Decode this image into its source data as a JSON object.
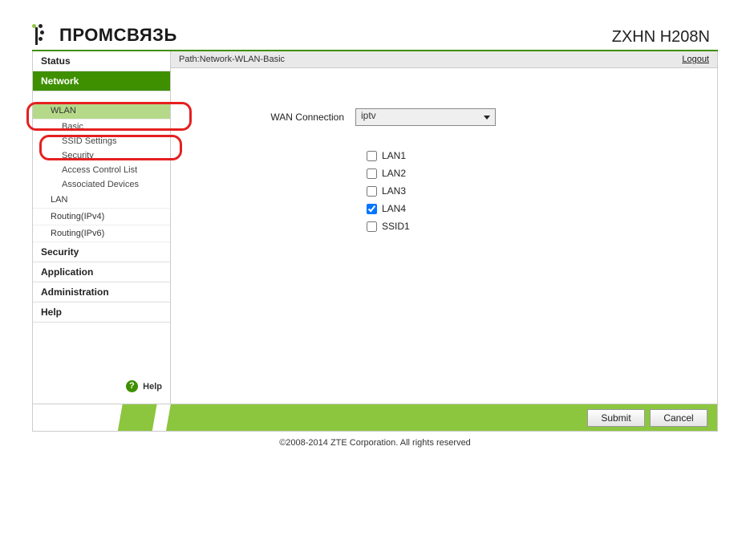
{
  "header": {
    "brand": "ПРОМСВЯЗЬ",
    "model": "ZXHN H208N"
  },
  "pathbar": {
    "prefix": "Path:",
    "path": "Network-WLAN-Basic",
    "logout": "Logout"
  },
  "sidebar": {
    "status": "Status",
    "network": "Network",
    "wlan": "WLAN",
    "basic": "Basic",
    "ssid_settings": "SSID Settings",
    "security_sub": "Security",
    "acl": "Access Control List",
    "assoc": "Associated Devices",
    "lan": "LAN",
    "routing4": "Routing(IPv4)",
    "routing6": "Routing(IPv6)",
    "security": "Security",
    "application": "Application",
    "administration": "Administration",
    "help": "Help",
    "help_bottom": "Help"
  },
  "form": {
    "wan_label": "WAN Connection",
    "wan_value": "iptv",
    "ports": [
      {
        "label": "LAN1",
        "checked": false
      },
      {
        "label": "LAN2",
        "checked": false
      },
      {
        "label": "LAN3",
        "checked": false
      },
      {
        "label": "LAN4",
        "checked": true
      },
      {
        "label": "SSID1",
        "checked": false
      }
    ],
    "submit": "Submit",
    "cancel": "Cancel"
  },
  "footer": {
    "copyright": "©2008-2014 ZTE Corporation. All rights reserved"
  }
}
